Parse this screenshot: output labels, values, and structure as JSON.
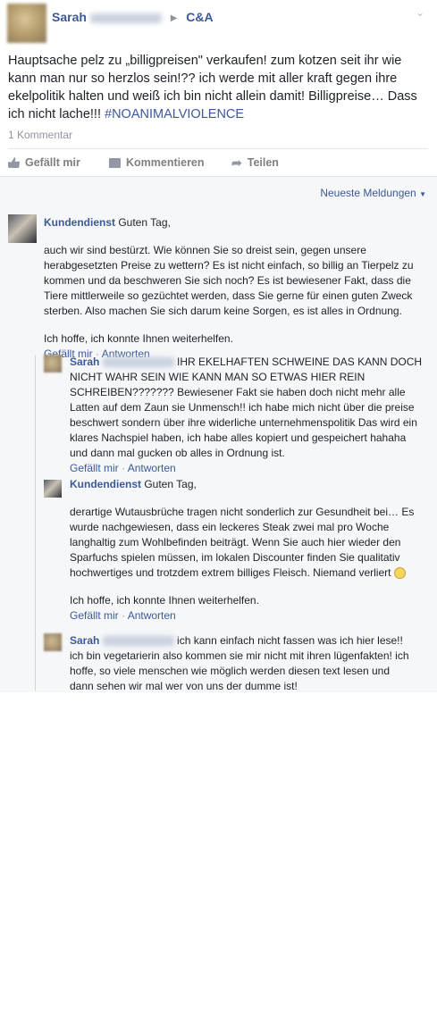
{
  "post": {
    "author": "Sarah",
    "target": "C&A",
    "text": "Hauptsache pelz zu „billigpreisen\" verkaufen! zum kotzen seit ihr wie kann man nur so herzlos sein!?? ich werde mit aller kraft gegen ihre ekelpolitik halten und weiß ich bin nicht allein damit! Billigpreise… Dass ich nicht lache!!! ",
    "hashtag": "#NOANIMALVIOLENCE",
    "comment_count": "1 Kommentar"
  },
  "actions": {
    "like": "Gefällt mir",
    "comment": "Kommentieren",
    "share": "Teilen"
  },
  "sort_label": "Neueste Meldungen",
  "icons": {
    "like": "thumbs-up-icon",
    "comment": "comment-bubble-icon",
    "share": "share-arrow-icon",
    "menu": "chevron-down-icon",
    "arrow": "triangle-right-icon"
  },
  "comments": [
    {
      "author": "Kundendienst",
      "intro": "Guten Tag,",
      "paragraphs": [
        "auch wir sind bestürzt. Wie können Sie so dreist sein, gegen unsere herabgesetzten Preise zu wettern? Es ist nicht einfach, so billig an Tierpelz zu kommen und da beschweren Sie sich noch? Es ist bewiesener Fakt, dass die Tiere mittlerweile so gezüchtet werden, dass Sie gerne für einen guten Zweck sterben. Also machen Sie sich darum keine Sorgen, es ist alles in Ordnung.",
        "Ich hoffe, ich konnte Ihnen weiterhelfen."
      ],
      "like": "Gefällt mir",
      "reply": "Antworten"
    },
    {
      "author": "Sarah",
      "text": "IHR EKELHAFTEN SCHWEINE DAS KANN DOCH NICHT WAHR SEIN WIE KANN MAN SO ETWAS HIER REIN SCHREIBEN??????? Bewiesener Fakt sie haben doch nicht mehr alle Latten auf dem Zaun sie Unmensch!! ich habe mich nicht über die preise beschwert sondern über ihre widerliche unternehmenspolitik Das wird ein klares Nachspiel haben, ich habe alles kopiert und gespeichert hahaha und dann mal gucken ob alles in Ordnung ist.",
      "like": "Gefällt mir",
      "reply": "Antworten"
    },
    {
      "author": "Kundendienst",
      "intro": "Guten Tag,",
      "paragraphs": [
        "derartige Wutausbrüche tragen nicht sonderlich zur Gesundheit bei… Es wurde nachgewiesen, dass ein leckeres Steak zwei mal pro Woche langhaltig zum Wohlbefinden beiträgt. Wenn Sie auch hier wieder den Sparfuchs spielen müssen, im lokalen Discounter finden Sie qualitativ hochwertiges und trotzdem extrem billiges Fleisch. Niemand verliert",
        "Ich hoffe, ich konnte Ihnen weiterhelfen."
      ],
      "like": "Gefällt mir",
      "reply": "Antworten"
    },
    {
      "author": "Sarah",
      "text": "ich kann einfach nicht fassen was ich hier lese!! ich bin vegetarierin also kommen sie mir nicht mit ihren lügenfakten! ich hoffe, so viele menschen wie möglich werden diesen text lesen und dann sehen wir mal wer von uns der dumme ist!"
    }
  ]
}
